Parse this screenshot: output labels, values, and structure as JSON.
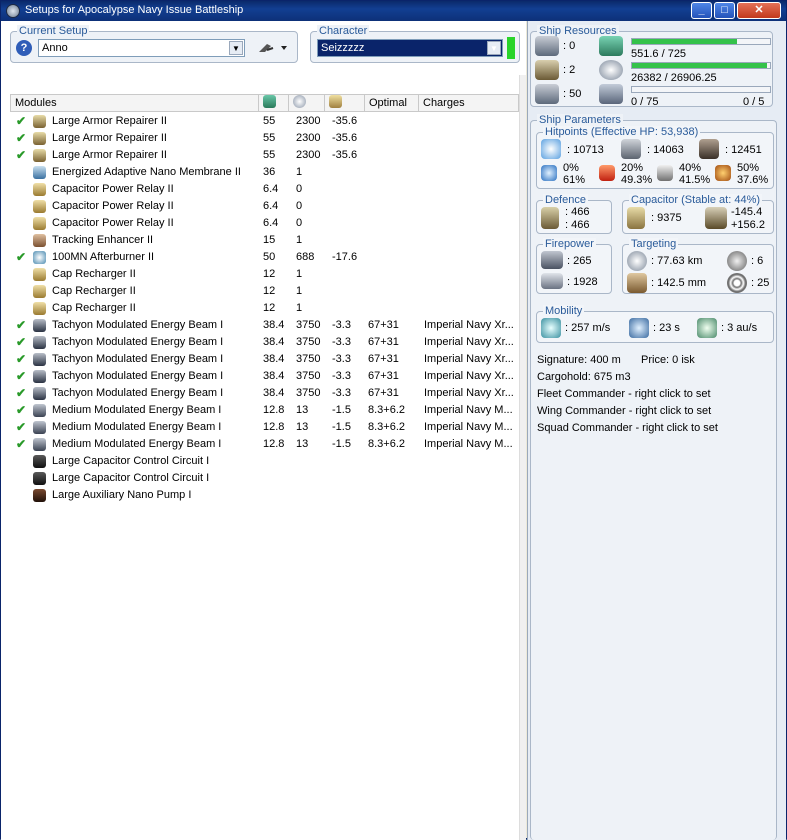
{
  "window": {
    "title": "Setups for Apocalypse Navy Issue Battleship"
  },
  "current_setup": {
    "legend": "Current Setup",
    "value": "Anno"
  },
  "character": {
    "legend": "Character",
    "value": "Seizzzzz"
  },
  "modules_table": {
    "headers": [
      "Modules",
      "",
      "",
      "",
      "Optimal",
      "Charges"
    ],
    "rows": [
      {
        "check": "✔",
        "name": "Large Armor Repairer II",
        "cpu": "55",
        "pg": "2300",
        "cap": "-35.6",
        "optimal": "",
        "charges": ""
      },
      {
        "check": "✔",
        "name": "Large Armor Repairer II",
        "cpu": "55",
        "pg": "2300",
        "cap": "-35.6",
        "optimal": "",
        "charges": ""
      },
      {
        "check": "✔",
        "name": "Large Armor Repairer II",
        "cpu": "55",
        "pg": "2300",
        "cap": "-35.6",
        "optimal": "",
        "charges": ""
      },
      {
        "check": "",
        "name": "Energized Adaptive Nano Membrane II",
        "cpu": "36",
        "pg": "1",
        "cap": "",
        "optimal": "",
        "charges": ""
      },
      {
        "check": "",
        "name": "Capacitor Power Relay II",
        "cpu": "6.4",
        "pg": "0",
        "cap": "",
        "optimal": "",
        "charges": ""
      },
      {
        "check": "",
        "name": "Capacitor Power Relay II",
        "cpu": "6.4",
        "pg": "0",
        "cap": "",
        "optimal": "",
        "charges": ""
      },
      {
        "check": "",
        "name": "Capacitor Power Relay II",
        "cpu": "6.4",
        "pg": "0",
        "cap": "",
        "optimal": "",
        "charges": ""
      },
      {
        "check": "",
        "name": "Tracking Enhancer II",
        "cpu": "15",
        "pg": "1",
        "cap": "",
        "optimal": "",
        "charges": ""
      },
      {
        "check": "✔",
        "name": "100MN Afterburner II",
        "cpu": "50",
        "pg": "688",
        "cap": "-17.6",
        "optimal": "",
        "charges": ""
      },
      {
        "check": "",
        "name": "Cap Recharger II",
        "cpu": "12",
        "pg": "1",
        "cap": "",
        "optimal": "",
        "charges": ""
      },
      {
        "check": "",
        "name": "Cap Recharger II",
        "cpu": "12",
        "pg": "1",
        "cap": "",
        "optimal": "",
        "charges": ""
      },
      {
        "check": "",
        "name": "Cap Recharger II",
        "cpu": "12",
        "pg": "1",
        "cap": "",
        "optimal": "",
        "charges": ""
      },
      {
        "check": "✔",
        "name": "Tachyon Modulated Energy Beam I",
        "cpu": "38.4",
        "pg": "3750",
        "cap": "-3.3",
        "optimal": "67+31",
        "charges": "Imperial Navy Xr..."
      },
      {
        "check": "✔",
        "name": "Tachyon Modulated Energy Beam I",
        "cpu": "38.4",
        "pg": "3750",
        "cap": "-3.3",
        "optimal": "67+31",
        "charges": "Imperial Navy Xr..."
      },
      {
        "check": "✔",
        "name": "Tachyon Modulated Energy Beam I",
        "cpu": "38.4",
        "pg": "3750",
        "cap": "-3.3",
        "optimal": "67+31",
        "charges": "Imperial Navy Xr..."
      },
      {
        "check": "✔",
        "name": "Tachyon Modulated Energy Beam I",
        "cpu": "38.4",
        "pg": "3750",
        "cap": "-3.3",
        "optimal": "67+31",
        "charges": "Imperial Navy Xr..."
      },
      {
        "check": "✔",
        "name": "Tachyon Modulated Energy Beam I",
        "cpu": "38.4",
        "pg": "3750",
        "cap": "-3.3",
        "optimal": "67+31",
        "charges": "Imperial Navy Xr..."
      },
      {
        "check": "✔",
        "name": "Medium Modulated Energy Beam I",
        "cpu": "12.8",
        "pg": "13",
        "cap": "-1.5",
        "optimal": "8.3+6.2",
        "charges": "Imperial Navy M..."
      },
      {
        "check": "✔",
        "name": "Medium Modulated Energy Beam I",
        "cpu": "12.8",
        "pg": "13",
        "cap": "-1.5",
        "optimal": "8.3+6.2",
        "charges": "Imperial Navy M..."
      },
      {
        "check": "✔",
        "name": "Medium Modulated Energy Beam I",
        "cpu": "12.8",
        "pg": "13",
        "cap": "-1.5",
        "optimal": "8.3+6.2",
        "charges": "Imperial Navy M..."
      },
      {
        "check": "",
        "name": "Large Capacitor Control Circuit I",
        "cpu": "",
        "pg": "",
        "cap": "",
        "optimal": "",
        "charges": ""
      },
      {
        "check": "",
        "name": "Large Capacitor Control Circuit I",
        "cpu": "",
        "pg": "",
        "cap": "",
        "optimal": "",
        "charges": ""
      },
      {
        "check": "",
        "name": "Large Auxiliary Nano Pump I",
        "cpu": "",
        "pg": "",
        "cap": "",
        "optimal": "",
        "charges": ""
      }
    ]
  },
  "ship_resources": {
    "legend": "Ship Resources",
    "turret_slots": ": 0",
    "launcher_slots": ": 2",
    "calibration": ": 50",
    "cpu": "551.6 / 725",
    "cpu_fraction": 0.76,
    "powergrid": "26382 / 26906.25",
    "pg_fraction": 0.98,
    "drone_bay": "0 / 75",
    "drone_bw": "0 / 5",
    "drone_fraction": 0.0
  },
  "ship_parameters": {
    "legend": "Ship Parameters",
    "hitpoints": {
      "legend": "Hitpoints (Effective HP: 53,938)",
      "shield": ": 10713",
      "armor": ": 14063",
      "structure": ": 12451",
      "em": "0%",
      "em2": "61%",
      "thermal": "20%",
      "thermal2": "49.3%",
      "kinetic": "40%",
      "kinetic2": "41.5%",
      "explosive": "50%",
      "explosive2": "37.6%"
    },
    "defence": {
      "legend": "Defence",
      "v1": ": 466",
      "v2": ": 466"
    },
    "capacitor": {
      "legend": "Capacitor (Stable at: 44%)",
      "amount": ": 9375",
      "use": "-145.4",
      "recharge": "+156.2"
    },
    "firepower": {
      "legend": "Firepower",
      "dps": ": 265",
      "volley": ": 1928"
    },
    "targeting": {
      "legend": "Targeting",
      "range": ": 77.63 km",
      "max_targets": ": 6",
      "scan_res": ": 142.5 mm",
      "sensor": ": 25"
    },
    "mobility": {
      "legend": "Mobility",
      "speed": ": 257 m/s",
      "align": ": 23 s",
      "warp": ": 3 au/s"
    },
    "signature": "Signature: 400 m",
    "price": "Price: 0 isk",
    "cargohold": "Cargohold: 675 m3",
    "fleet_commander": "Fleet Commander - right click to set",
    "wing_commander": "Wing Commander - right click to set",
    "squad_commander": "Squad Commander - right click to set"
  }
}
